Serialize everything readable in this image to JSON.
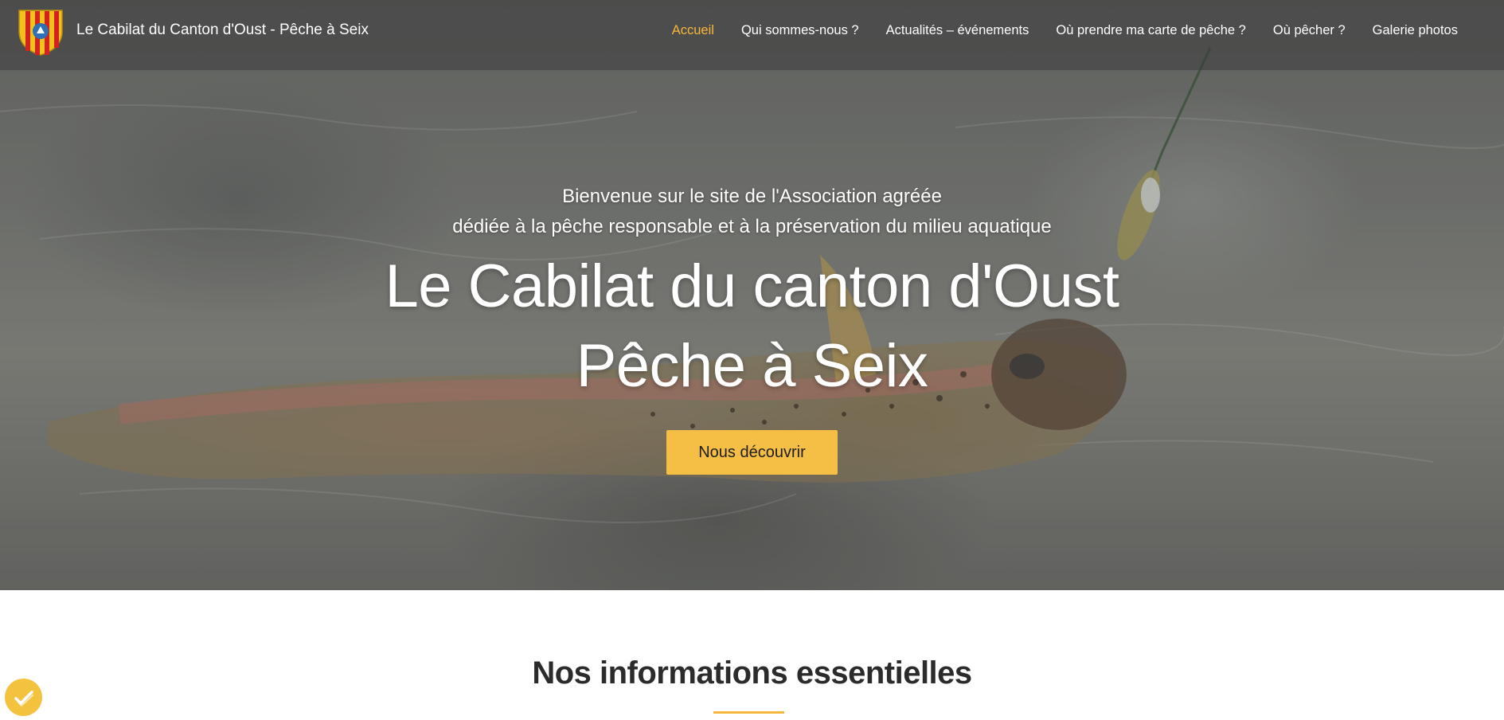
{
  "header": {
    "brand": "Le Cabilat du Canton d'Oust - Pêche à Seix",
    "nav": [
      {
        "label": "Accueil",
        "active": true
      },
      {
        "label": "Qui sommes-nous ?"
      },
      {
        "label": "Actualités – événements"
      },
      {
        "label": "Où prendre ma carte de pêche ?"
      },
      {
        "label": "Où pêcher ?"
      },
      {
        "label": "Galerie photos"
      }
    ]
  },
  "hero": {
    "intro_line1": "Bienvenue sur le site de l'Association agréée",
    "intro_line2": "dédiée à la pêche responsable et à la préservation du milieu aquatique",
    "title_line1": "Le Cabilat du canton d'Oust",
    "title_line2": "Pêche à Seix",
    "cta_label": "Nous découvrir"
  },
  "section": {
    "title": "Nos informations essentielles"
  },
  "icons": {
    "logo": "coat-of-arms-icon",
    "cookie": "cookie-consent-icon"
  },
  "colors": {
    "accent": "#f5b83b",
    "button": "#f5be45"
  }
}
